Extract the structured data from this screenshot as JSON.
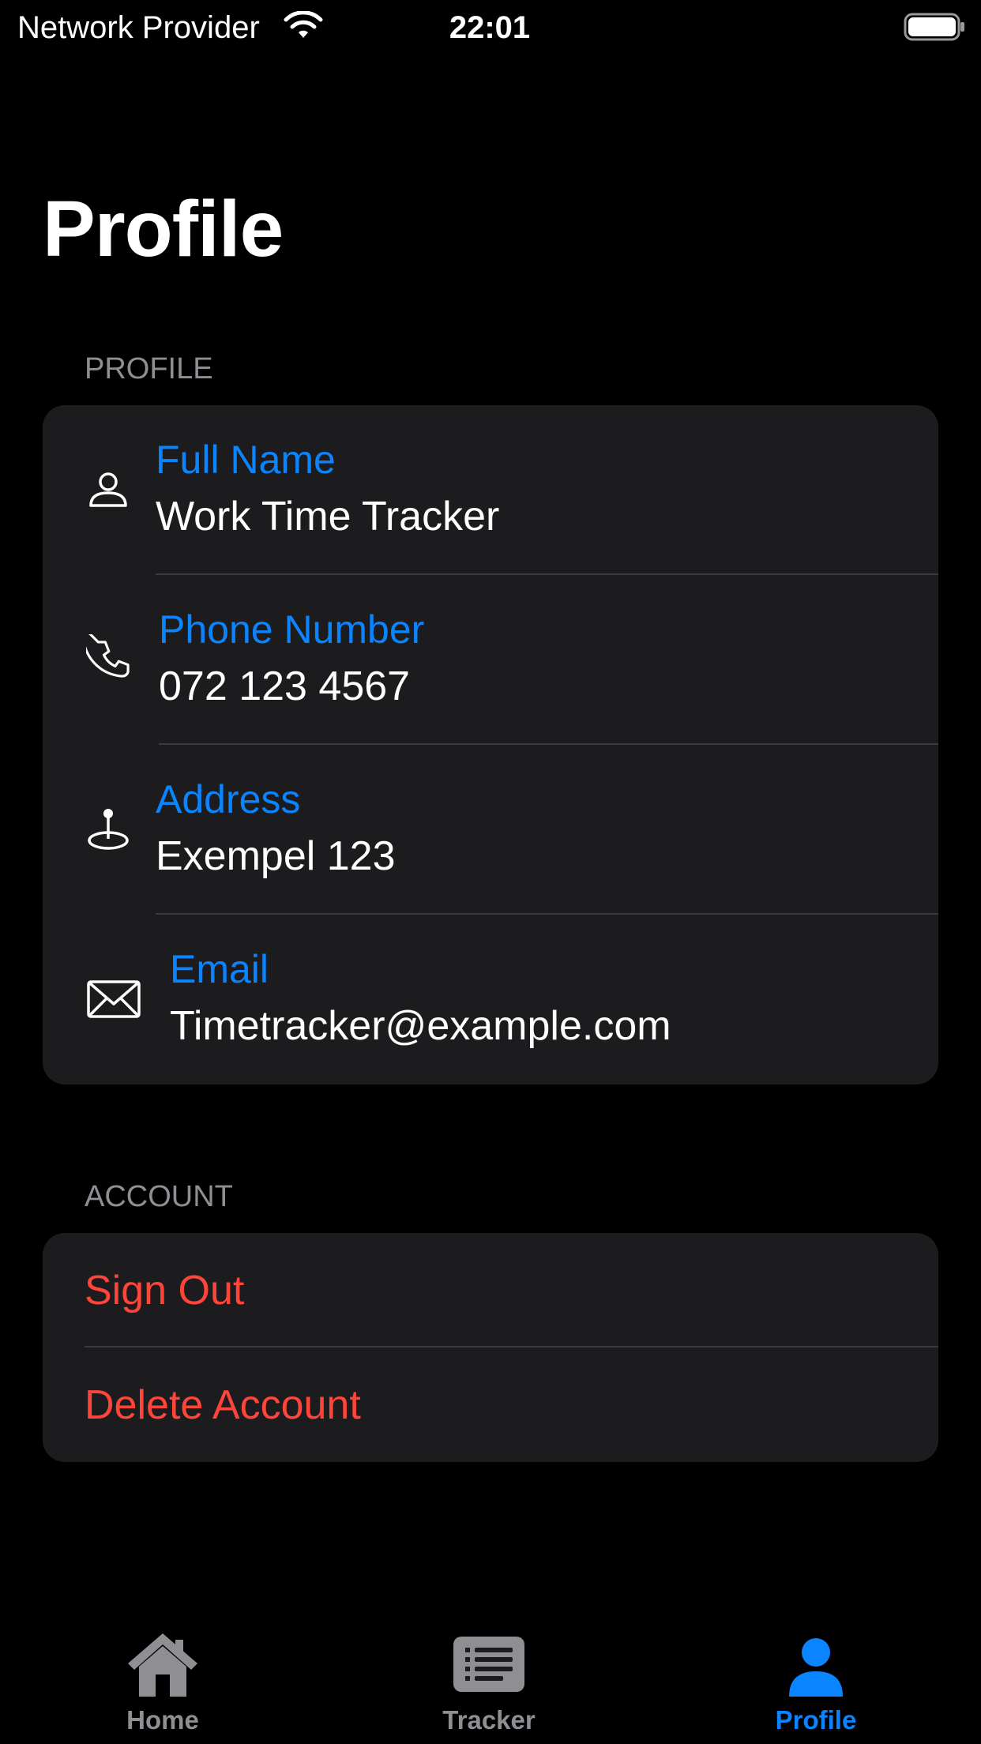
{
  "status_bar": {
    "carrier": "Network Provider",
    "time": "22:01",
    "wifi_icon": "wifi-icon",
    "battery_icon": "battery-icon"
  },
  "page": {
    "title": "Profile"
  },
  "profile_section": {
    "header": "PROFILE",
    "rows": [
      {
        "icon": "person-icon",
        "label": "Full Name",
        "value": "Work Time Tracker"
      },
      {
        "icon": "phone-icon",
        "label": "Phone Number",
        "value": "072 123 4567"
      },
      {
        "icon": "location-pin-icon",
        "label": "Address",
        "value": "Exempel 123"
      },
      {
        "icon": "envelope-icon",
        "label": "Email",
        "value": "Timetracker@example.com"
      }
    ]
  },
  "account_section": {
    "header": "ACCOUNT",
    "items": [
      {
        "label": "Sign Out"
      },
      {
        "label": "Delete Account"
      }
    ]
  },
  "tab_bar": {
    "tabs": [
      {
        "label": "Home",
        "icon": "house-icon",
        "active": false
      },
      {
        "label": "Tracker",
        "icon": "list-icon",
        "active": false
      },
      {
        "label": "Profile",
        "icon": "person-fill-icon",
        "active": true
      }
    ]
  },
  "colors": {
    "background": "#000000",
    "card": "#1c1c1e",
    "accent": "#0a84ff",
    "destructive": "#ff453a",
    "secondary_text": "#8e8e93",
    "separator": "#3a3a3c"
  }
}
